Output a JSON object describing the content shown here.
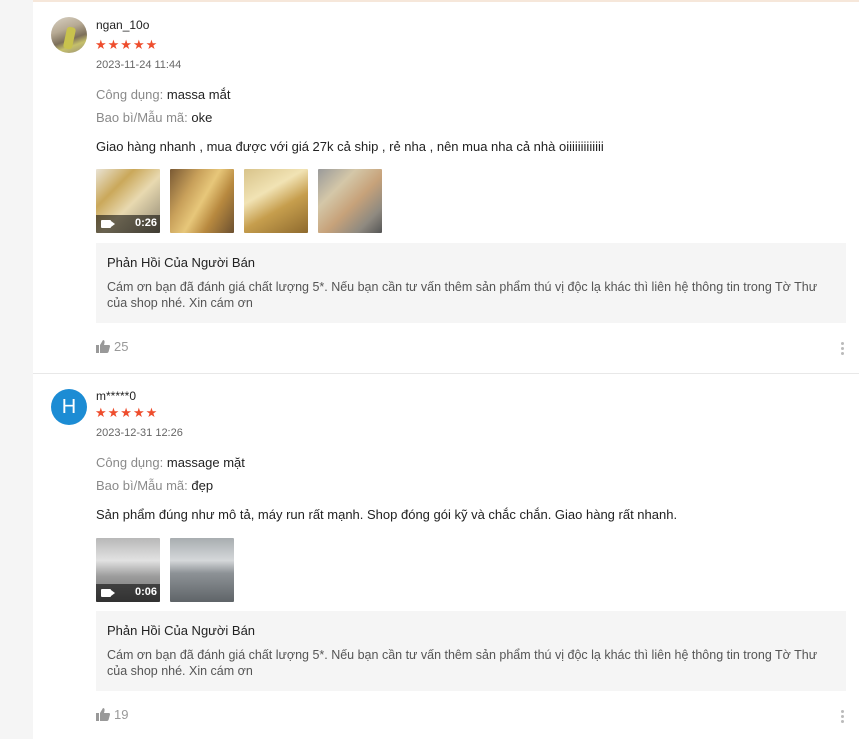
{
  "reviews": [
    {
      "username": "ngan_10o",
      "avatar_type": "photo",
      "stars": "★★★★★",
      "datetime": "2023-11-24 11:44",
      "attributes": [
        {
          "label": "Công dụng:",
          "value": "massa mắt"
        },
        {
          "label": "Bao bì/Mẫu mã:",
          "value": "oke"
        }
      ],
      "comment": "Giao hàng nhanh , mua được với giá 27k cả ship , rẻ nha , nên mua nha cả nhà oiiiiiiiiiiiii",
      "media": [
        {
          "kind": "video",
          "duration": "0:26"
        },
        {
          "kind": "image"
        },
        {
          "kind": "image"
        },
        {
          "kind": "image"
        }
      ],
      "seller_reply": {
        "title": "Phản Hồi Của Người Bán",
        "text": "Cám ơn bạn đã đánh giá chất lượng 5*. Nếu bạn cần tư vấn thêm sản phẩm thú vị độc lạ khác thì liên hệ thông tin trong Tờ Thư của shop nhé. Xin cám ơn"
      },
      "likes": "25"
    },
    {
      "username": "m*****0",
      "avatar_letter": "H",
      "stars": "★★★★★",
      "datetime": "2023-12-31 12:26",
      "attributes": [
        {
          "label": "Công dụng:",
          "value": "massage mặt"
        },
        {
          "label": "Bao bì/Mẫu mã:",
          "value": "đẹp"
        }
      ],
      "comment": "Sản phẩm đúng như mô tả, máy run rất mạnh. Shop đóng gói kỹ và chắc chắn. Giao hàng rất nhanh.",
      "media": [
        {
          "kind": "video",
          "duration": "0:06"
        },
        {
          "kind": "image"
        }
      ],
      "seller_reply": {
        "title": "Phản Hồi Của Người Bán",
        "text": "Cám ơn bạn đã đánh giá chất lượng 5*. Nếu bạn cần tư vấn thêm sản phẩm thú vị độc lạ khác thì liên hệ thông tin trong Tờ Thư của shop nhé. Xin cám ơn"
      },
      "likes": "19"
    }
  ],
  "colors": {
    "star": "#ee4d2d",
    "avatar_bg": "#1c8cd4",
    "reply_bg": "#f5f5f5"
  },
  "icons": {
    "like": "thumbs-up-icon",
    "more": "more-vertical-icon",
    "video": "video-camera-icon"
  }
}
